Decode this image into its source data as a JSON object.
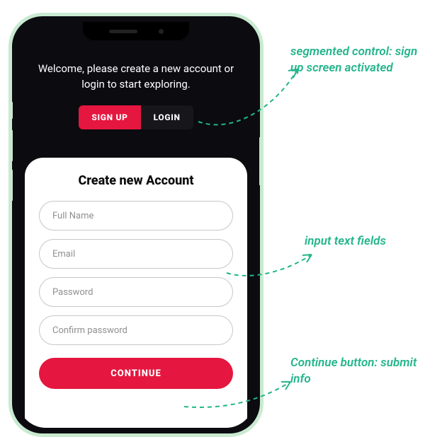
{
  "colors": {
    "accent": "#e5163f",
    "callout": "#23b58a",
    "frame": "#c9ead1",
    "screen": "#0b0b10"
  },
  "hero": {
    "welcome": "Welcome, please create a new account or login to start exploring."
  },
  "segmented": {
    "signup_label": "SIGN UP",
    "login_label": "LOGIN",
    "active": "signup"
  },
  "card": {
    "title": "Create new Account",
    "fields": [
      {
        "placeholder": "Full Name"
      },
      {
        "placeholder": "Email"
      },
      {
        "placeholder": "Password"
      },
      {
        "placeholder": "Confirm password"
      }
    ],
    "cta_label": "CONTINUE"
  },
  "annotations": {
    "segmented": "segmented control: sign up screen activated",
    "inputs": "input text fields",
    "continue": "Continue button: submit info"
  }
}
